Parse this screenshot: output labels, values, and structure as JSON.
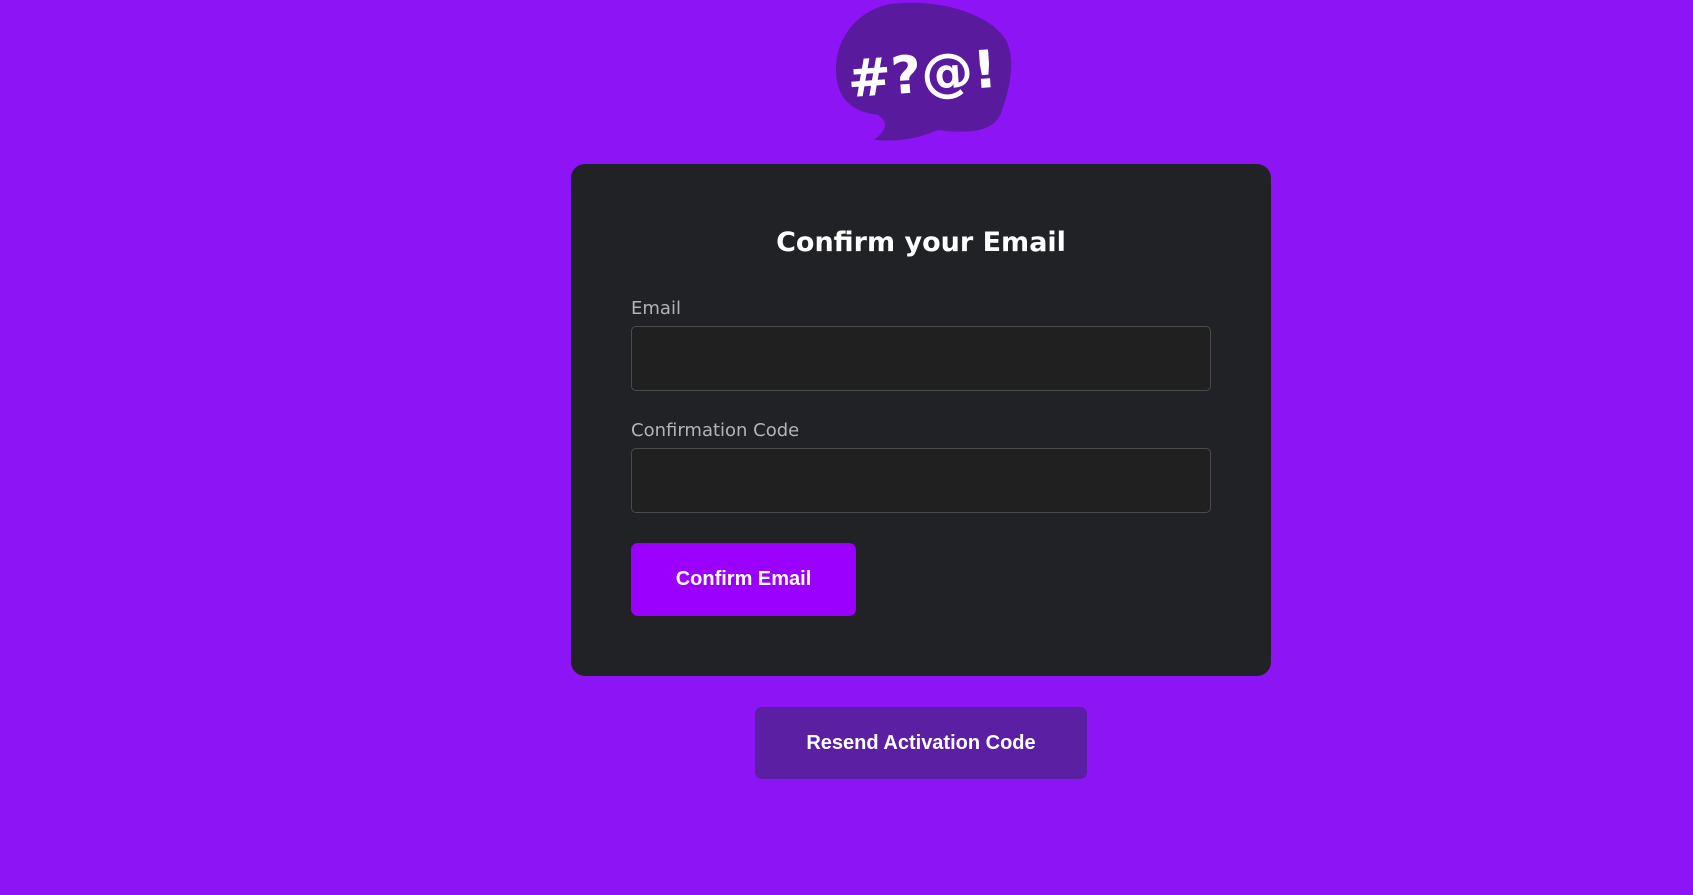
{
  "logo": {
    "icon": "speech-bubble-logo-icon",
    "text": "#?@!",
    "bubble_color": "#5a1a9e",
    "text_color": "#ffffff"
  },
  "form": {
    "title": "Confirm your Email",
    "email_label": "Email",
    "email_value": "",
    "email_placeholder": "",
    "code_label": "Confirmation Code",
    "code_value": "",
    "code_placeholder": "",
    "submit_label": "Confirm Email"
  },
  "resend": {
    "label": "Resend Activation Code"
  },
  "colors": {
    "background": "#8c14f5",
    "card": "#212226",
    "primary_button": "#9b00ff",
    "secondary_button": "#5a1fa2"
  }
}
